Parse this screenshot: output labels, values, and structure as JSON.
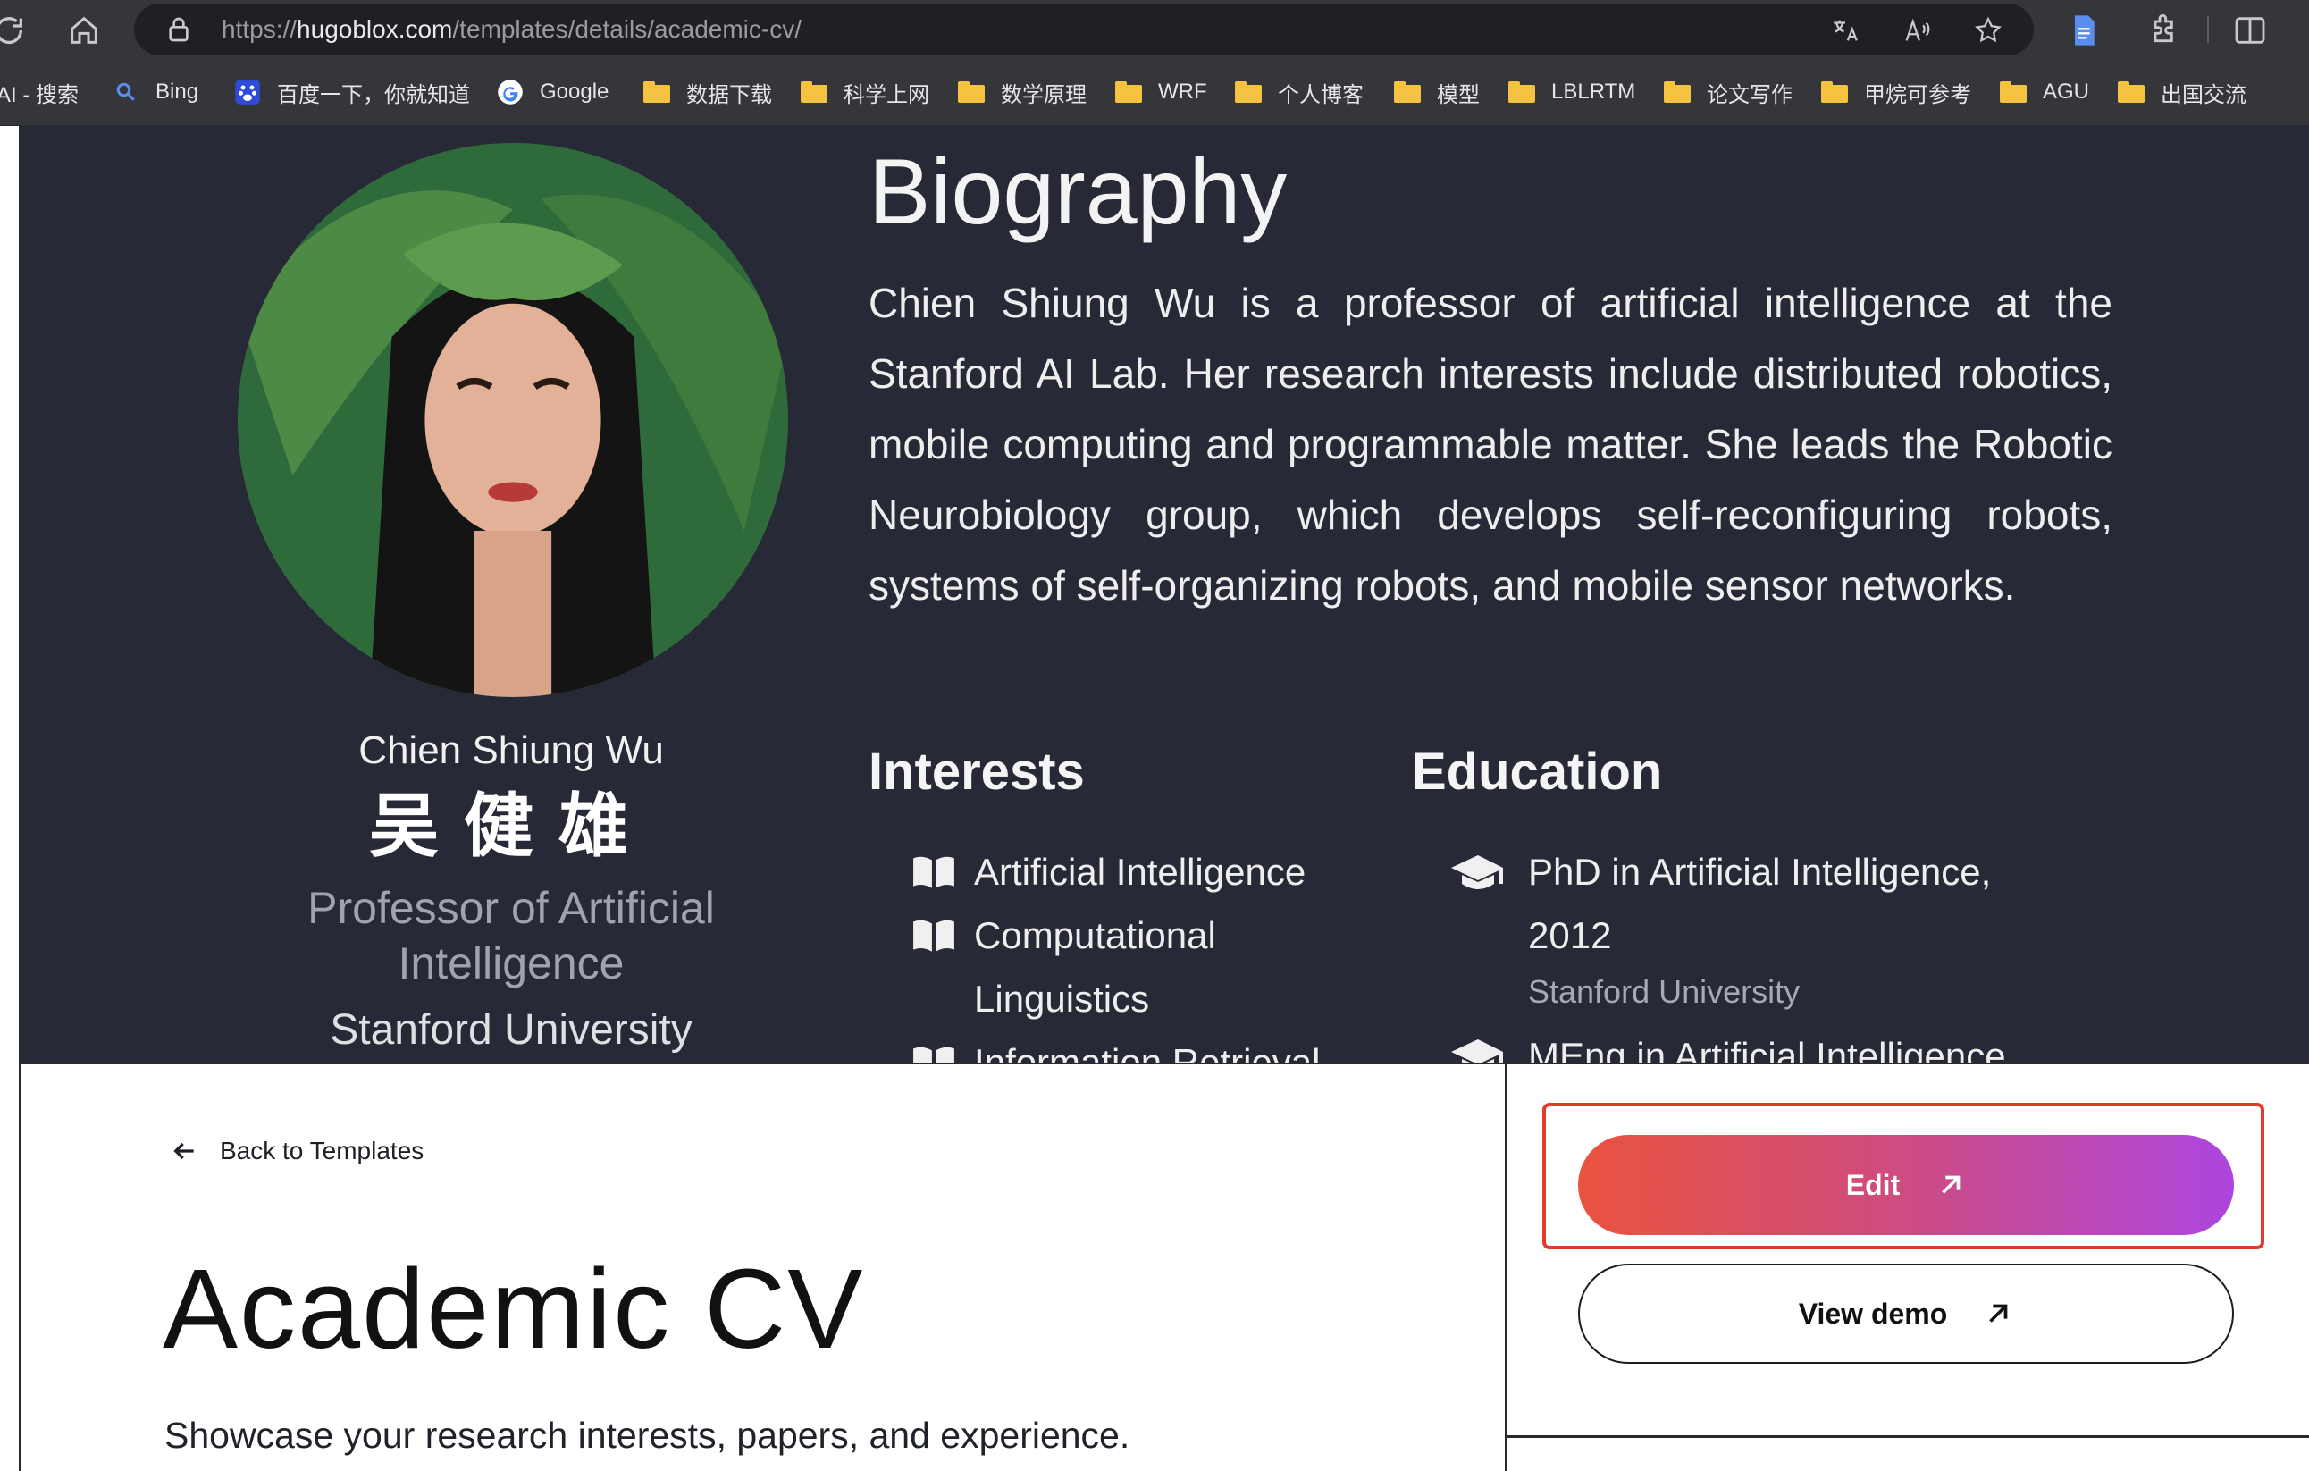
{
  "browser": {
    "url_prefix": "https://",
    "url_host": "hugoblox.com",
    "url_path": "/templates/details/academic-cv/",
    "read_aloud_icon": "read-aloud-icon",
    "translate_icon": "translate-icon"
  },
  "bookmarks": [
    {
      "label": "AI - 搜索",
      "icon": "none"
    },
    {
      "label": "Bing",
      "icon": "bing-search-icon"
    },
    {
      "label": "百度一下，你就知道",
      "icon": "baidu-icon"
    },
    {
      "label": "Google",
      "icon": "google-icon"
    },
    {
      "label": "数据下载",
      "icon": "folder-icon"
    },
    {
      "label": "科学上网",
      "icon": "folder-icon"
    },
    {
      "label": "数学原理",
      "icon": "folder-icon"
    },
    {
      "label": "WRF",
      "icon": "folder-icon"
    },
    {
      "label": "个人博客",
      "icon": "folder-icon"
    },
    {
      "label": "模型",
      "icon": "folder-icon"
    },
    {
      "label": "LBLRTM",
      "icon": "folder-icon"
    },
    {
      "label": "论文写作",
      "icon": "folder-icon"
    },
    {
      "label": "甲烷可参考",
      "icon": "folder-icon"
    },
    {
      "label": "AGU",
      "icon": "folder-icon"
    },
    {
      "label": "出国交流",
      "icon": "folder-icon"
    }
  ],
  "preview": {
    "name_en": "Chien Shiung Wu",
    "name_zh": "吴健雄",
    "role": "Professor of Artificial Intelligence",
    "organization": "Stanford University",
    "bio_title": "Biography",
    "bio_text": "Chien Shiung Wu is a professor of artificial intelligence at the Stanford AI Lab. Her research interests include distributed robotics, mobile computing and programmable matter. She leads the Robotic Neurobiology group, which develops self-reconfiguring robots, systems of self-organizing robots, and mobile sensor networks.",
    "interests_heading": "Interests",
    "interests": [
      "Artificial Intelligence",
      "Computational Linguistics",
      "Information Retrieval"
    ],
    "education_heading": "Education",
    "education": [
      {
        "course": "PhD in Artificial Intelligence, 2012",
        "institution": "Stanford University"
      },
      {
        "course": "MEng in Artificial Intelligence",
        "institution": ""
      }
    ]
  },
  "page": {
    "back_label": "Back to Templates",
    "title": "Academic CV",
    "description": "Showcase your research interests, papers, and experience.",
    "edit_label": "Edit",
    "view_demo_label": "View demo"
  },
  "colors": {
    "edit_gradient_start": "#e9533f",
    "edit_gradient_end": "#ad46df",
    "highlight_border": "#e03c2c",
    "hero_background": "#272a36"
  }
}
